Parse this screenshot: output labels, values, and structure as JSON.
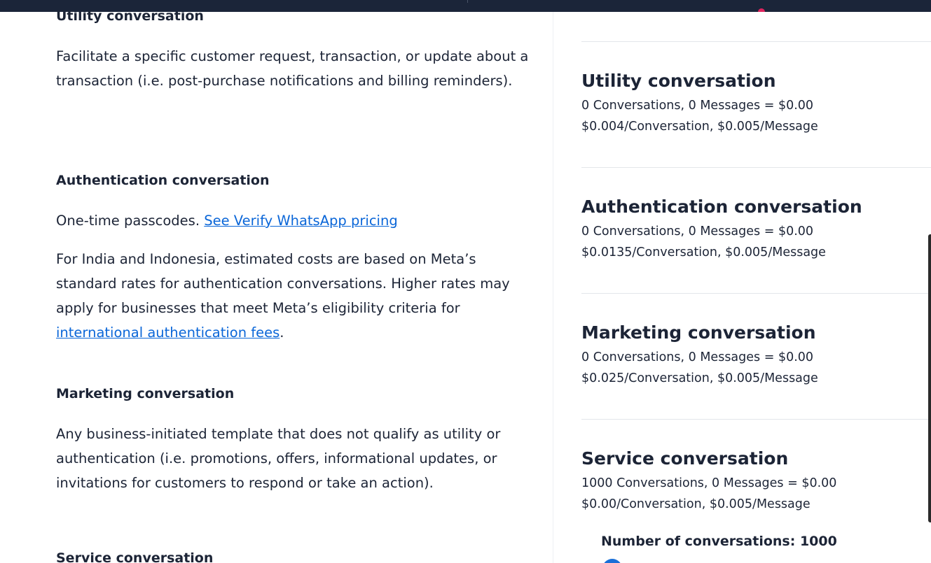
{
  "left_panel": {
    "utility": {
      "heading": "Utility conversation",
      "description": "Facilitate a specific customer request, transaction, or update about a transaction (i.e. post-purchase notifications and billing reminders)."
    },
    "authentication": {
      "heading": "Authentication conversation",
      "description_prefix": "One-time passcodes. ",
      "verify_link": "See Verify WhatsApp pricing",
      "note_text": "For India and Indonesia, estimated costs are based on Meta’s standard rates for authentication conversations. Higher rates may apply for businesses that meet Meta’s eligibility criteria for ",
      "intl_link": "international authentication fees",
      "note_suffix": "."
    },
    "marketing": {
      "heading": "Marketing conversation",
      "description": "Any business-initiated template that does not qualify as utility or authentication (i.e. promotions, offers, informational updates, or invitations for customers to respond or take an action)."
    },
    "service": {
      "heading": "Service conversation"
    }
  },
  "right_panel": {
    "cards": [
      {
        "title": "Utility conversation",
        "summary": "0 Conversations, 0 Messages = $0.00",
        "rates": "$0.004/Conversation, $0.005/Message"
      },
      {
        "title": "Authentication conversation",
        "summary": "0 Conversations, 0 Messages = $0.00",
        "rates": "$0.0135/Conversation, $0.005/Message"
      },
      {
        "title": "Marketing conversation",
        "summary": "0 Conversations, 0 Messages = $0.00",
        "rates": "$0.025/Conversation, $0.005/Message"
      },
      {
        "title": "Service conversation",
        "summary": "1000 Conversations, 0 Messages = $0.00",
        "rates": "$0.00/Conversation, $0.005/Message"
      }
    ],
    "conversations_label": "Number of conversations: 1000"
  },
  "colors": {
    "topbar": "#1b2539",
    "link": "#0a66d8",
    "text": "#1c2436",
    "slider": "#1a6fd8",
    "notification_dot": "#e0245e"
  }
}
